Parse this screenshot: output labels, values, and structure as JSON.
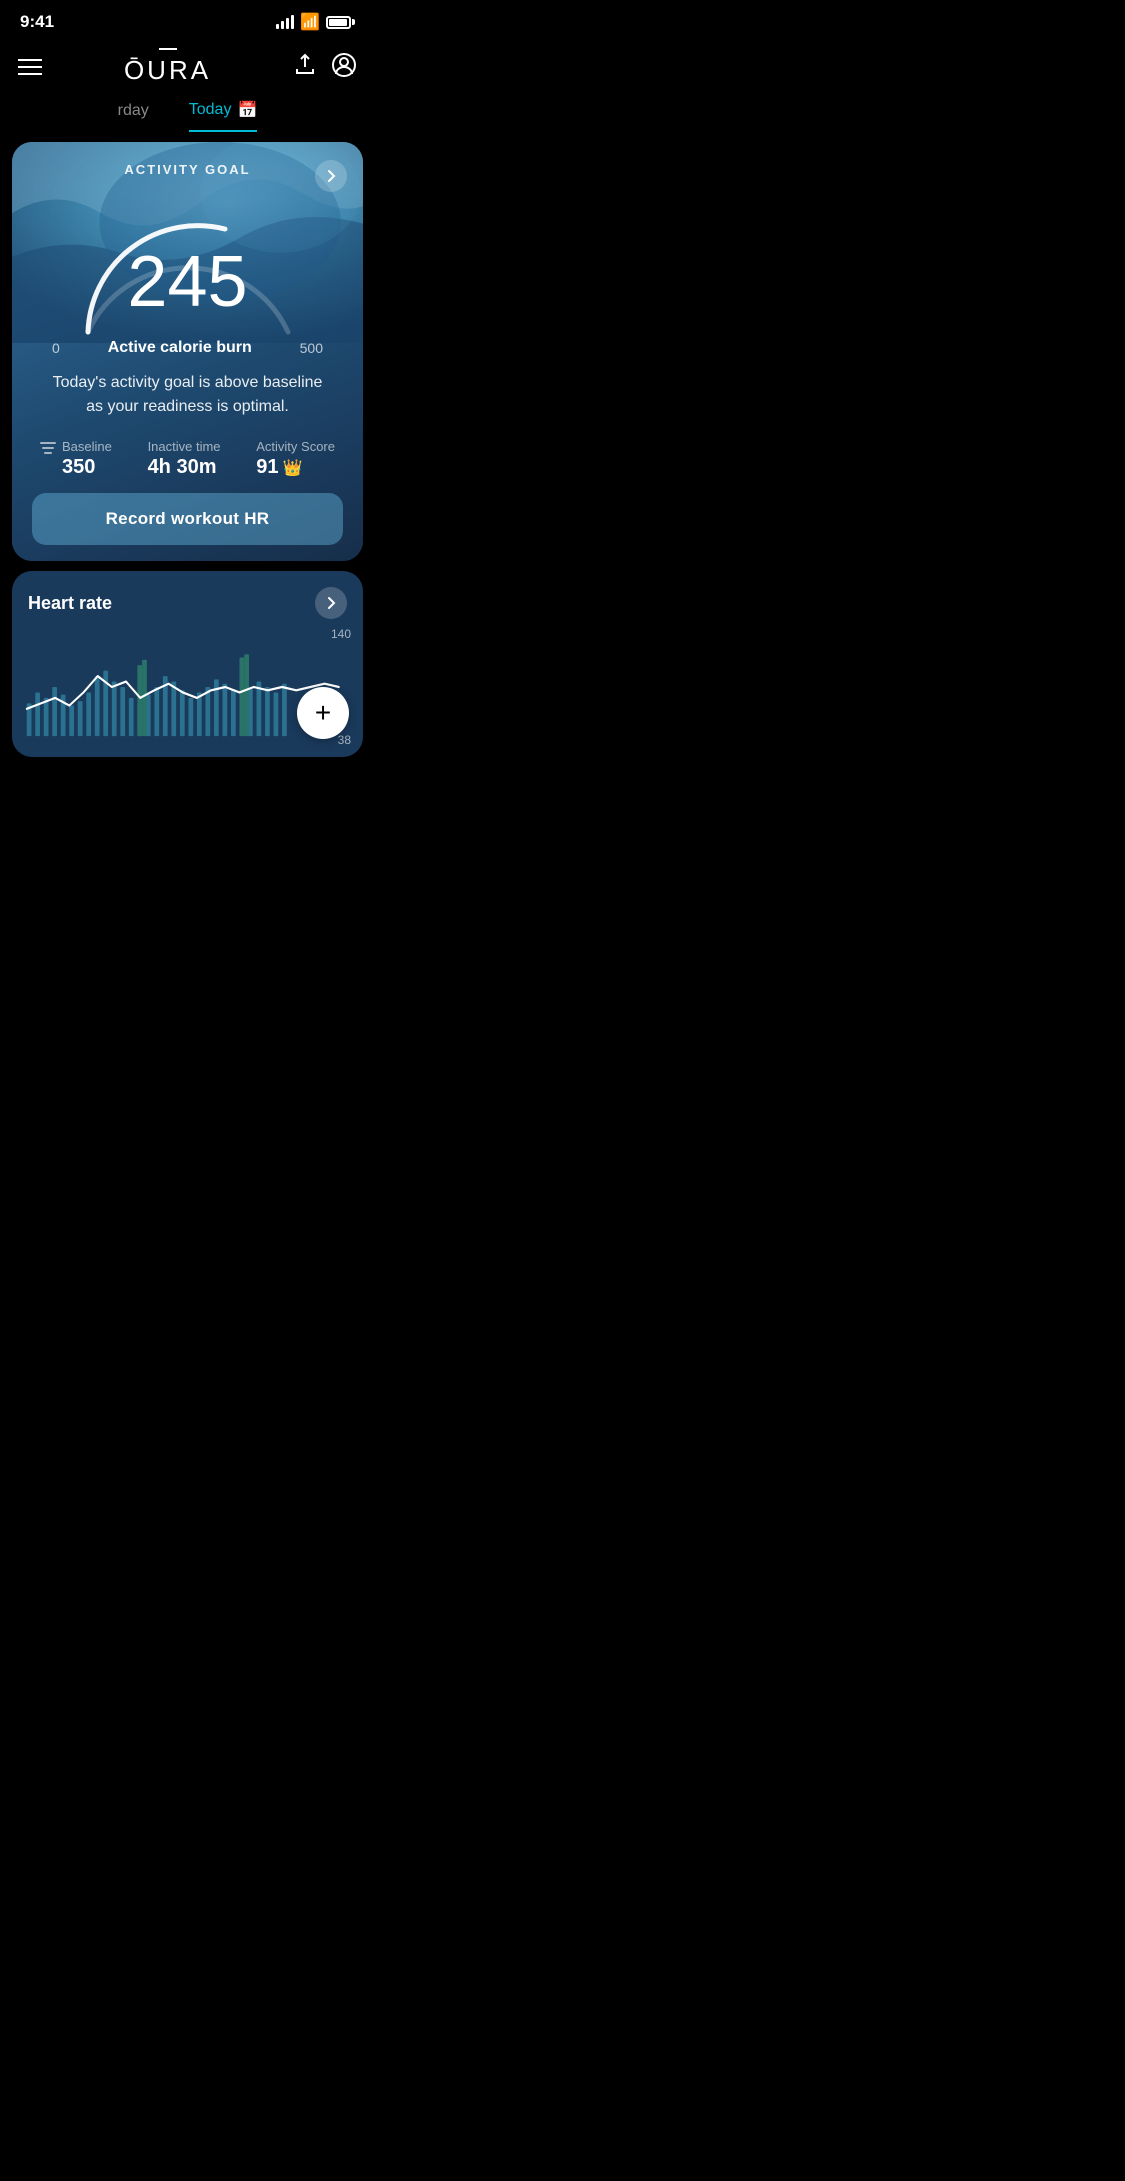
{
  "statusBar": {
    "time": "9:41"
  },
  "header": {
    "logo": "ŌURA",
    "shareLabel": "share",
    "profileLabel": "profile"
  },
  "navTabs": {
    "prev": "rday",
    "today": "Today",
    "todayIcon": "📅"
  },
  "activityCard": {
    "title": "ACTIVITY GOAL",
    "chevron": "→",
    "gaugeValue": "245",
    "gaugeMin": "0",
    "gaugeMax": "500",
    "gaugeLabel": "Active calorie burn",
    "descriptionText": "Today's activity goal is above baseline as your readiness is optimal.",
    "baseline": {
      "label": "Baseline",
      "value": "350"
    },
    "inactiveTime": {
      "label": "Inactive time",
      "value": "4h 30m"
    },
    "activityScore": {
      "label": "Activity Score",
      "value": "91",
      "crownIcon": "👑"
    },
    "workoutButton": "Record workout HR"
  },
  "heartRateCard": {
    "title": "Heart rate",
    "chevron": "→",
    "yMax": "140",
    "yMin": "38",
    "fabIcon": "+"
  }
}
